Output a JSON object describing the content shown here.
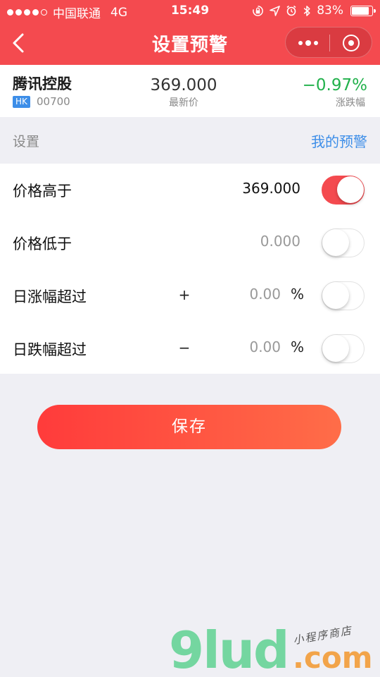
{
  "status_bar": {
    "carrier": "中国联通",
    "network": "4G",
    "time": "15:49",
    "battery": "83%"
  },
  "nav": {
    "title": "设置预警"
  },
  "stock": {
    "name": "腾讯控股",
    "market": "HK",
    "code": "00700",
    "price": "369.000",
    "price_label": "最新价",
    "change": "−0.97%",
    "change_label": "涨跌幅"
  },
  "section": {
    "label": "设置",
    "link": "我的预警"
  },
  "alerts": [
    {
      "label": "价格高于",
      "sign": "",
      "value": "369.000",
      "unit": "",
      "enabled": true
    },
    {
      "label": "价格低于",
      "sign": "",
      "value": "0.000",
      "unit": "",
      "enabled": false
    },
    {
      "label": "日涨幅超过",
      "sign": "+",
      "value": "0.00",
      "unit": "%",
      "enabled": false
    },
    {
      "label": "日跌幅超过",
      "sign": "−",
      "value": "0.00",
      "unit": "%",
      "enabled": false
    }
  ],
  "save_label": "保存",
  "watermark": {
    "logo": "9lud",
    "domain": ".com",
    "tagline": "小程序商店"
  },
  "colors": {
    "primary": "#f44a4f",
    "link": "#3d8ee8",
    "down": "#22b14c"
  }
}
